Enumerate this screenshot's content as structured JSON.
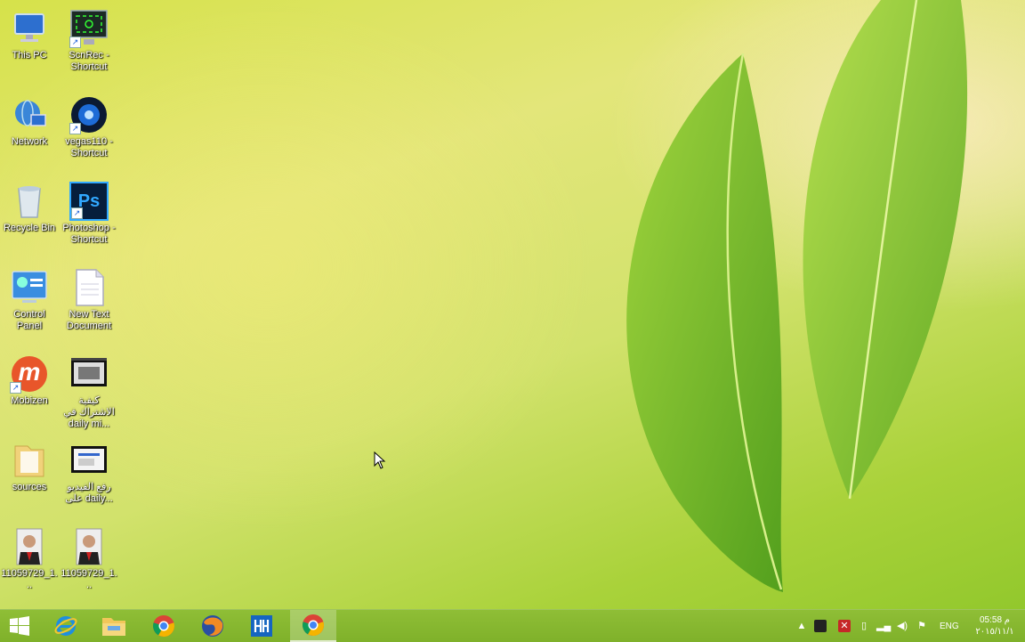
{
  "desktop": {
    "icons": [
      {
        "label": "This PC",
        "icon": "this-pc-icon"
      },
      {
        "label": "ScnRec - Shortcut",
        "icon": "screen-recorder-icon"
      },
      {
        "label": "Network",
        "icon": "network-icon"
      },
      {
        "label": "vegas110 - Shortcut",
        "icon": "vegas-icon"
      },
      {
        "label": "Recycle Bin",
        "icon": "recycle-bin-icon"
      },
      {
        "label": "Photoshop - Shortcut",
        "icon": "photoshop-icon"
      },
      {
        "label": "Control Panel",
        "icon": "control-panel-icon"
      },
      {
        "label": "New Text Document",
        "icon": "text-document-icon"
      },
      {
        "label": "Mobizen",
        "icon": "mobizen-icon"
      },
      {
        "label": "كيفية الاشتراك في daily mi...",
        "icon": "video-file-icon"
      },
      {
        "label": "sources",
        "icon": "folder-icon"
      },
      {
        "label": "رفع الفيديو على daily...",
        "icon": "video-file-icon"
      },
      {
        "label": "11059729_1...",
        "icon": "photo-icon"
      },
      {
        "label": "11059729_1...",
        "icon": "photo-icon"
      }
    ],
    "photoshop_glyph": "Ps",
    "mobizen_glyph": "m"
  },
  "taskbar": {
    "apps": [
      {
        "name": "start",
        "icon": "windows-logo-icon"
      },
      {
        "name": "internet-explorer",
        "icon": "internet-explorer-icon"
      },
      {
        "name": "file-explorer",
        "icon": "folder-icon"
      },
      {
        "name": "chrome",
        "icon": "chrome-icon"
      },
      {
        "name": "firefox",
        "icon": "firefox-icon"
      },
      {
        "name": "app",
        "icon": "app-icon"
      },
      {
        "name": "chrome-active",
        "icon": "chrome-icon"
      }
    ],
    "tray": {
      "language": "ENG",
      "time": "05:58 م",
      "date": "٢٠١٥/١١/١"
    }
  },
  "colors": {
    "taskbar": "#86b830",
    "accent_leaf": "#6fb82a"
  }
}
